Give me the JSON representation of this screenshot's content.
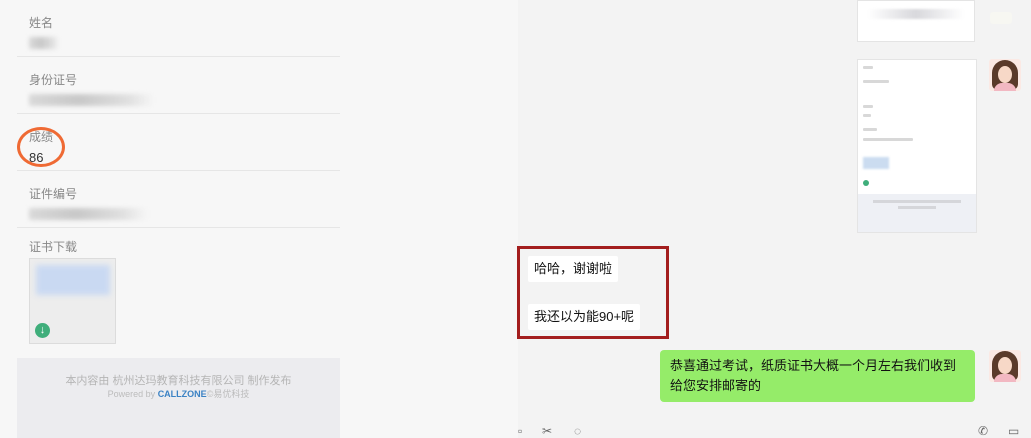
{
  "certificate_page": {
    "fields": [
      {
        "label": "姓名",
        "value": ""
      },
      {
        "label": "身份证号",
        "value": ""
      },
      {
        "label": "成绩",
        "value": "86"
      },
      {
        "label": "证件编号",
        "value": ""
      }
    ],
    "download_label": "证书下载",
    "footer": {
      "line1": "本内容由 杭州达玛教育科技有限公司 制作发布",
      "powered_prefix": "Powered by ",
      "brand": "CALLZONE",
      "powered_suffix": "©易优科技"
    }
  },
  "chat": {
    "incoming": [
      {
        "text": "哈哈，谢谢啦"
      },
      {
        "text": "我还以为能90+呢"
      }
    ],
    "outgoing": [
      {
        "text": "恭喜通过考试，纸质证书大概一个月左右我们收到给您安排邮寄的"
      }
    ]
  },
  "colors": {
    "annotation_circle": "#ef6a34",
    "highlight_box": "#a31e1e",
    "outgoing_bubble": "#95ec69"
  }
}
